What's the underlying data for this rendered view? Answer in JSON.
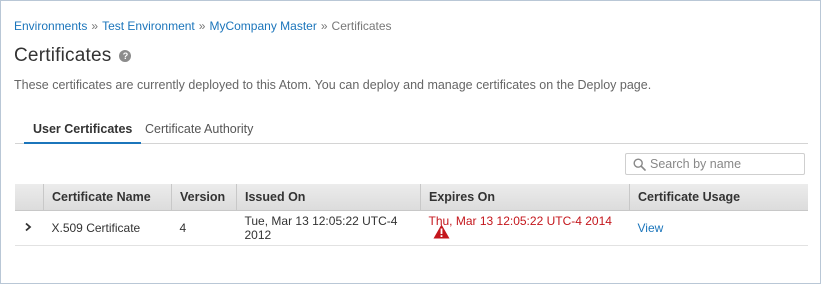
{
  "breadcrumb": {
    "items": [
      "Environments",
      "Test Environment",
      "MyCompany Master"
    ],
    "separator": "»",
    "current": "Certificates"
  },
  "page": {
    "title": "Certificates",
    "help_icon": "?",
    "description": "These certificates are currently deployed to this Atom. You can deploy and manage certificates on the Deploy page."
  },
  "tabs": [
    {
      "label": "User Certificates",
      "active": true
    },
    {
      "label": "Certificate Authority",
      "active": false
    }
  ],
  "search": {
    "placeholder": "Search by name",
    "icon": "search-icon"
  },
  "table": {
    "headers": [
      "Certificate Name",
      "Version",
      "Issued On",
      "Expires On",
      "Certificate Usage"
    ],
    "rows": [
      {
        "name": "X.509 Certificate",
        "version": "4",
        "issued_on": "Tue, Mar 13 12:05:22 UTC-4 2012",
        "expires_on": "Thu, Mar 13 12:05:22 UTC-4 2014",
        "expired": true,
        "usage_link": "View"
      }
    ]
  },
  "colors": {
    "link": "#1b75bb",
    "expired": "#c4161c",
    "tab_active_underline": "#1b75bb"
  }
}
